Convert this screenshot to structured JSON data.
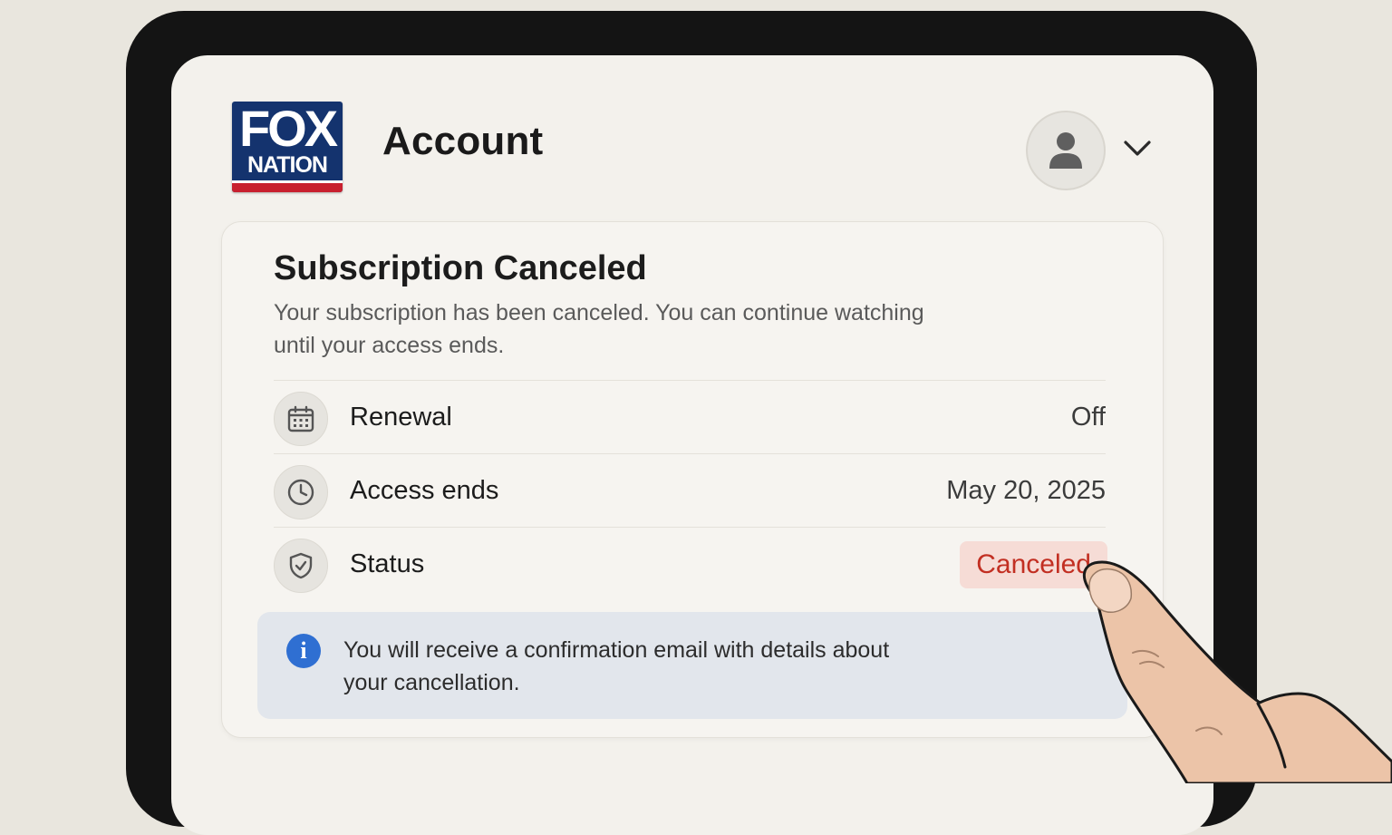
{
  "brand": {
    "logo_line1": "FOX",
    "logo_line2": "NATION"
  },
  "header": {
    "title": "Account",
    "avatar_icon": "user-icon",
    "menu_icon": "chevron-down-icon"
  },
  "card": {
    "title": "Subscription Canceled",
    "description": "Your subscription has been canceled. You can continue watching until your access ends.",
    "rows": [
      {
        "icon": "calendar-icon",
        "label": "Renewal",
        "value": "Off"
      },
      {
        "icon": "clock-icon",
        "label": "Access ends",
        "value": "May 20, 2025"
      },
      {
        "icon": "shield-check-icon",
        "label": "Status",
        "value": "Canceled"
      }
    ],
    "notice": {
      "icon": "info-icon",
      "text": "You will receive a confirmation email with details about your cancellation."
    }
  },
  "colors": {
    "accent_blue": "#2f6fd2",
    "status_canceled_text": "#c22f22",
    "status_canceled_bg": "#f6dcd6",
    "brand_navy": "#14336e",
    "brand_red": "#c8202f"
  }
}
